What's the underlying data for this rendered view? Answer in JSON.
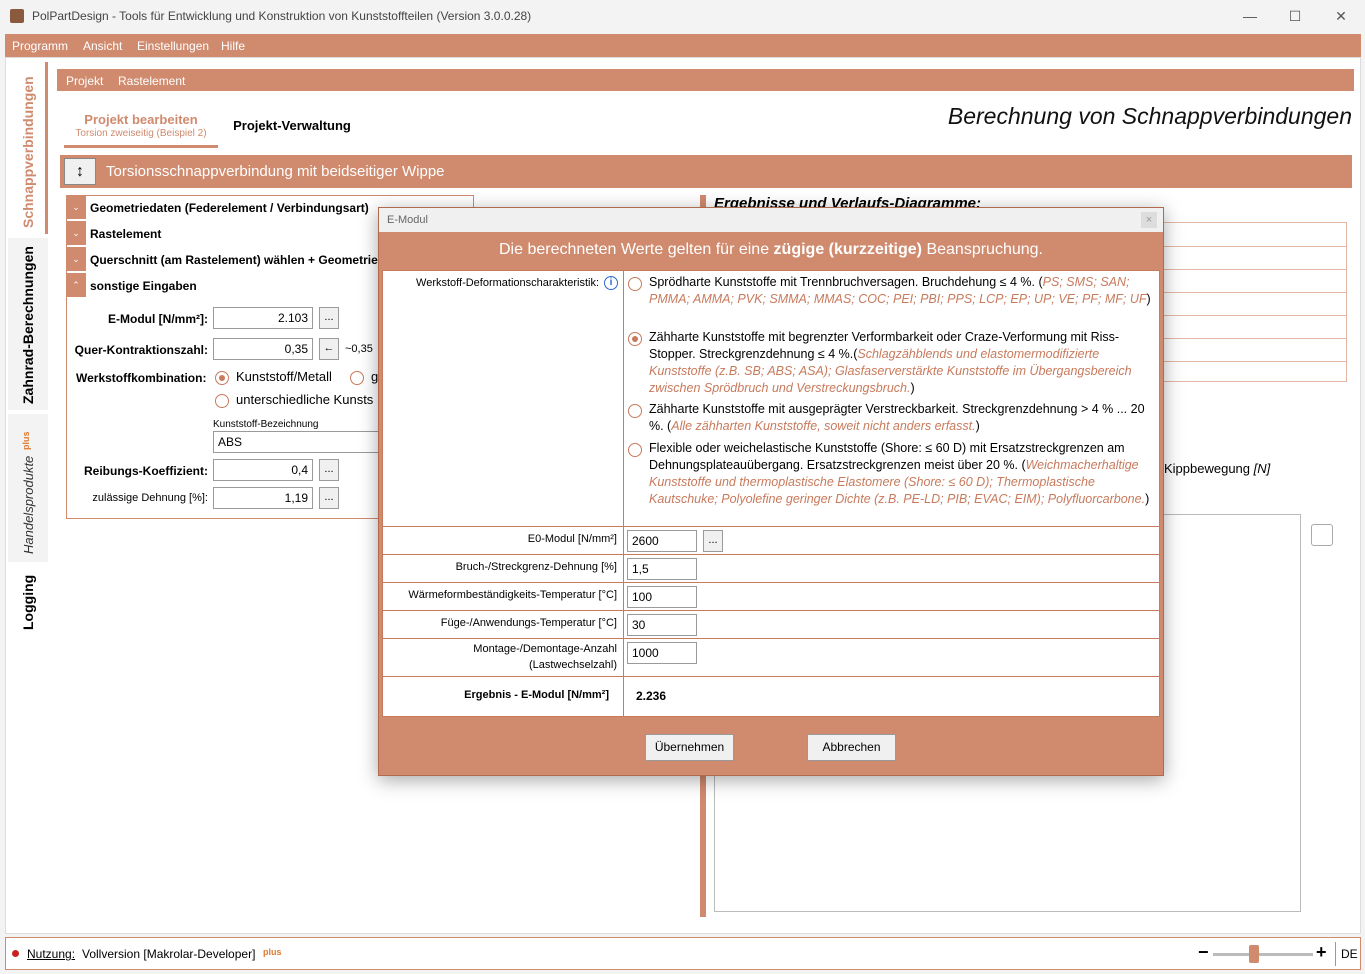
{
  "window": {
    "title": "PolPartDesign - Tools für Entwicklung und Konstruktion von Kunststoffteilen (Version 3.0.0.28)",
    "minimize": "—",
    "maximize": "☐",
    "close": "✕"
  },
  "menu": [
    "Programm",
    "Ansicht",
    "Einstellungen",
    "Hilfe"
  ],
  "sidebar_tabs": [
    "Schnappverbindungen",
    "Zahnrad-Berechnungen",
    "Handelsprodukte",
    "plus",
    "Logging"
  ],
  "submenu": [
    "Projekt",
    "Rastelement"
  ],
  "project_tabs": {
    "edit_label": "Projekt bearbeiten",
    "edit_sub": "Torsion zweiseitig (Beispiel 2)",
    "manage_label": "Projekt-Verwaltung"
  },
  "page_heading": "Berechnung von Schnappverbindungen",
  "header_title": "Torsionsschnappverbindung mit beidseitiger Wippe",
  "header_toggle_icon": "↕",
  "sections": [
    "Geometriedaten (Federelement / Verbindungsart)",
    "Rastelement",
    "Querschnitt (am Rastelement) wählen + Geometrie",
    "sonstige Eingaben"
  ],
  "form": {
    "emodul_label": "E-Modul [N/mm²]:",
    "emodul_value": "2.103",
    "querk_label": "Quer-Kontraktionszahl:",
    "querk_value": "0,35",
    "querk_arrow": "←",
    "querk_approx": "~0,35",
    "werkstoff_label": "Werkstoffkombination:",
    "opt1": "Kunststoff/Metall",
    "opt2": "g",
    "opt3": "unterschiedliche Kunsts",
    "bezeichnung_label": "Kunststoff-Bezeichnung",
    "bezeichnung_value": "ABS",
    "reibung_label": "Reibungs-Koeffizient:",
    "reibung_value": "0,4",
    "dehnung_label": "zulässige Dehnung [%]:",
    "dehnung_value": "1,19",
    "dots": "..."
  },
  "right_panel": {
    "heading": "Ergebnisse und Verlaufs-Diagramme:",
    "kipp_label": "Kippbewegung",
    "kipp_unit": "[N]"
  },
  "dialog": {
    "title": "E-Modul",
    "close": "×",
    "banner_pre": "Die berechneten Werte gelten für eine ",
    "banner_bold": "zügige (kurzzeitige)",
    "banner_post": " Beanspruchung.",
    "char_label": "Werkstoff-Deformationscharakteristik:",
    "info_icon": "i",
    "options": [
      {
        "text": "Sprödharte Kunststoffe mit Trennbruchversagen. Bruchdehung ≤ 4 %. (",
        "italic": "PS; SMS; SAN; PMMA; AMMA; PVK; SMMA; MMAS; COC; PEI; PBI; PPS; LCP; EP; UP; VE; PF; MF; UF",
        "tail": ")"
      },
      {
        "text": "Zähharte Kunststoffe mit begrenzter Verformbarkeit oder Craze-Verformung mit Riss-Stopper. Streckgrenzdehnung ≤ 4 %.(",
        "italic": "Schlagzähblends und elastomermodifizierte Kunststoffe (z.B. SB; ABS; ASA); Glasfaserverstärkte Kunststoffe im Übergangsbereich zwischen Sprödbruch und Verstreckungsbruch.",
        "tail": ")"
      },
      {
        "text": "Zähharte Kunststoffe mit ausgeprägter Verstreckbarkeit. Streckgrenzdehnung > 4 % ... 20 %. (",
        "italic": "Alle zähharten Kunststoffe, soweit nicht anders erfasst.",
        "tail": ")"
      },
      {
        "text": "Flexible oder weichelastische Kunststoffe (Shore: ≤ 60 D) mit Ersatzstreckgrenzen am Dehnungsplateauübergang. Ersatzstreckgrenzen meist über 20 %. (",
        "italic": "Weichmacherhaltige Kunststoffe und thermoplastische Elastomere (Shore: ≤ 60 D); Thermoplastische Kautschuke; Polyolefine geringer Dichte (z.B. PE-LD; PIB; EVAC; EIM); Polyfluorcarbone.",
        "tail": ")"
      }
    ],
    "selected_option": 2,
    "fields": [
      {
        "label": "E0-Modul [N/mm²]",
        "value": "2600"
      },
      {
        "label": "Bruch-/Streckgrenz-Dehnung [%]",
        "value": "1,5"
      },
      {
        "label": "Wärmeformbeständigkeits-Temperatur [°C]",
        "value": "100"
      },
      {
        "label": "Füge-/Anwendungs-Temperatur [°C]",
        "value": "30"
      },
      {
        "label": "Montage-/Demontage-Anzahl",
        "label2": "(Lastwechselzahl)",
        "value": "1000"
      }
    ],
    "result_label": "Ergebnis - E-Modul [N/mm²]",
    "result_value": "2.236",
    "ok_label": "Übernehmen",
    "cancel_label": "Abbrechen"
  },
  "status": {
    "usage_label": "Nutzung:",
    "usage_value": "Vollversion [Makrolar-Developer]",
    "plus": "plus",
    "zoom_minus": "−",
    "zoom_plus": "+",
    "zoom_level": 0.4,
    "lang": "DE"
  },
  "colors": {
    "accent": "#d08a6e",
    "accent_dark": "#c87a5c",
    "status_dot": "#cc1f1f"
  }
}
